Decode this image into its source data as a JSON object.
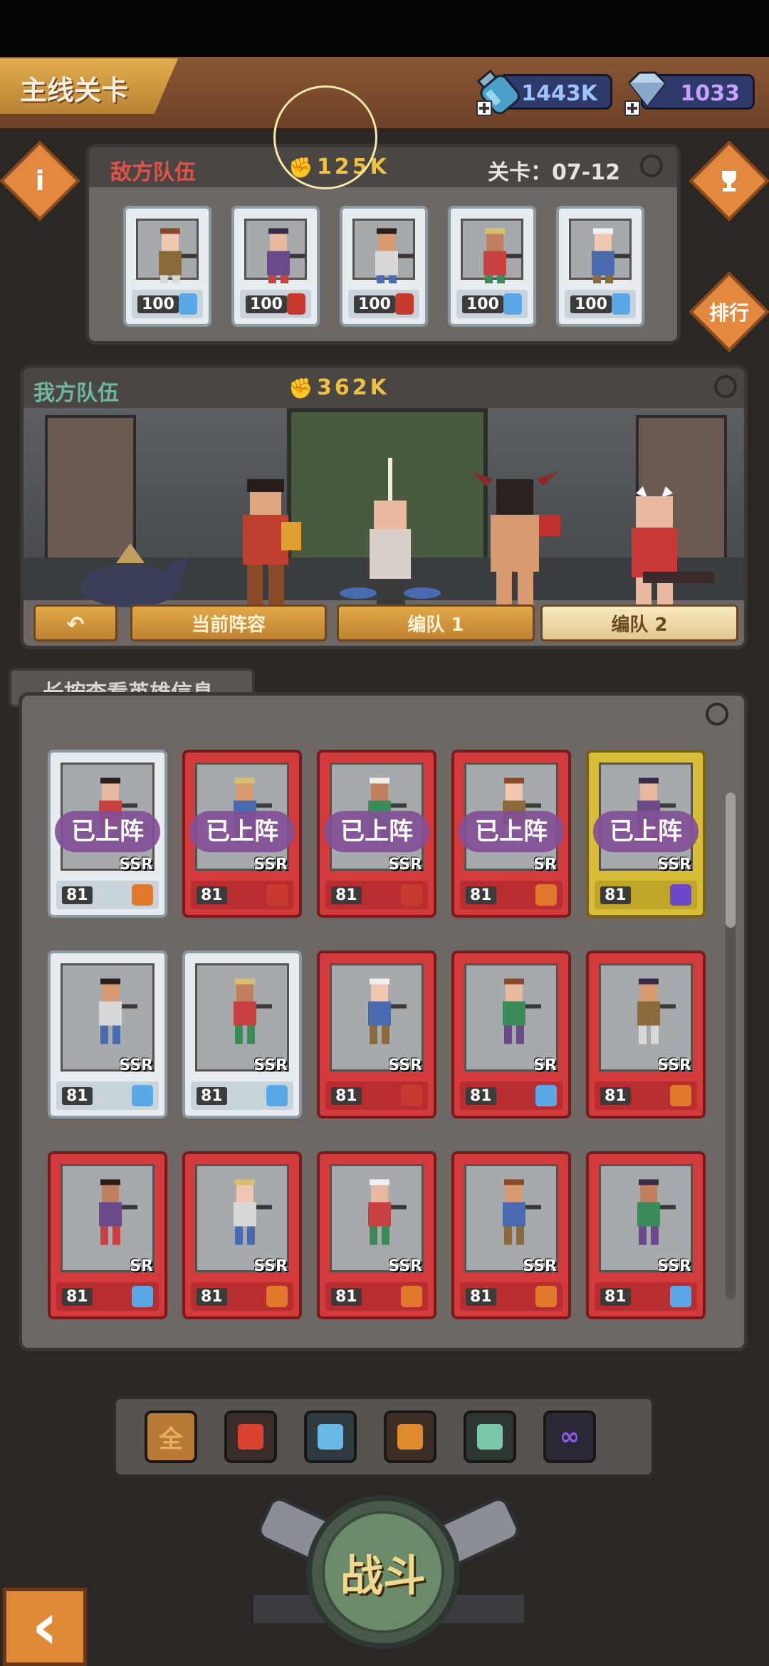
{
  "header": {
    "title": "主线关卡",
    "resource1": {
      "value": "1443K",
      "icon": "potion-bottle-icon"
    },
    "resource2": {
      "value": "1033",
      "icon": "diamond-gem-icon"
    }
  },
  "side_buttons": {
    "info": "i",
    "trophy": "trophy-icon",
    "rank": "排行"
  },
  "enemy": {
    "label": "敌方队伍",
    "power": "125K",
    "stage": "关卡：07-12",
    "cards": [
      {
        "level": "100",
        "style": "white",
        "faction_color": "#5aa8e8"
      },
      {
        "level": "100",
        "style": "white",
        "faction_color": "#c83a30"
      },
      {
        "level": "100",
        "style": "white",
        "faction_color": "#c83a30"
      },
      {
        "level": "100",
        "style": "white",
        "faction_color": "#5aa8e8"
      },
      {
        "level": "100",
        "style": "white",
        "faction_color": "#5aa8e8"
      }
    ]
  },
  "ally": {
    "label": "我方队伍",
    "power": "362K",
    "tabs": {
      "back": "↶",
      "current": "当前阵容",
      "team1": "编队 1",
      "team2": "编队 2"
    }
  },
  "hero_list": {
    "hint": "长按查看英雄信息",
    "deployed_label": "已上阵",
    "rows": [
      [
        {
          "rarity": "SSR",
          "level": "81",
          "style": "white",
          "deployed": true,
          "faction_color": "#e07a2a"
        },
        {
          "rarity": "SSR",
          "level": "81",
          "style": "red",
          "deployed": true,
          "faction_color": "#c83a30"
        },
        {
          "rarity": "SSR",
          "level": "81",
          "style": "red",
          "deployed": true,
          "faction_color": "#c83a30"
        },
        {
          "rarity": "SR",
          "level": "81",
          "style": "red",
          "deployed": true,
          "faction_color": "#e07a2a"
        },
        {
          "rarity": "SSR",
          "level": "81",
          "style": "gold",
          "deployed": true,
          "faction_color": "#6a48c8"
        }
      ],
      [
        {
          "rarity": "SSR",
          "level": "81",
          "style": "white",
          "deployed": false,
          "faction_color": "#5aa8e8"
        },
        {
          "rarity": "SSR",
          "level": "81",
          "style": "white",
          "deployed": false,
          "faction_color": "#5aa8e8"
        },
        {
          "rarity": "SSR",
          "level": "81",
          "style": "red",
          "deployed": false,
          "faction_color": "#c83a30"
        },
        {
          "rarity": "SR",
          "level": "81",
          "style": "red",
          "deployed": false,
          "faction_color": "#5aa8e8"
        },
        {
          "rarity": "SSR",
          "level": "81",
          "style": "red",
          "deployed": false,
          "faction_color": "#e07a2a"
        }
      ],
      [
        {
          "rarity": "SR",
          "level": "81",
          "style": "red",
          "deployed": false,
          "faction_color": "#5aa8e8"
        },
        {
          "rarity": "SSR",
          "level": "81",
          "style": "red",
          "deployed": false,
          "faction_color": "#e07a2a"
        },
        {
          "rarity": "SSR",
          "level": "81",
          "style": "red",
          "deployed": false,
          "faction_color": "#e07a2a"
        },
        {
          "rarity": "SSR",
          "level": "81",
          "style": "red",
          "deployed": false,
          "faction_color": "#e07a2a"
        },
        {
          "rarity": "SSR",
          "level": "81",
          "style": "red",
          "deployed": false,
          "faction_color": "#5aa8e8"
        }
      ]
    ]
  },
  "filters": [
    {
      "label": "全",
      "color": "#e8b060",
      "bg": "#b87a34"
    },
    {
      "label": "",
      "color": "#d84030",
      "bg": "#3a2e2b"
    },
    {
      "label": "",
      "color": "#6ab8e8",
      "bg": "#2e3a40"
    },
    {
      "label": "",
      "color": "#e08a30",
      "bg": "#3d2e26"
    },
    {
      "label": "",
      "color": "#7ac8a8",
      "bg": "#2e3632"
    },
    {
      "label": "∞",
      "color": "#8a5ce8",
      "bg": "#2c2838"
    }
  ],
  "battle": {
    "label": "战斗"
  },
  "back_button": "‹"
}
